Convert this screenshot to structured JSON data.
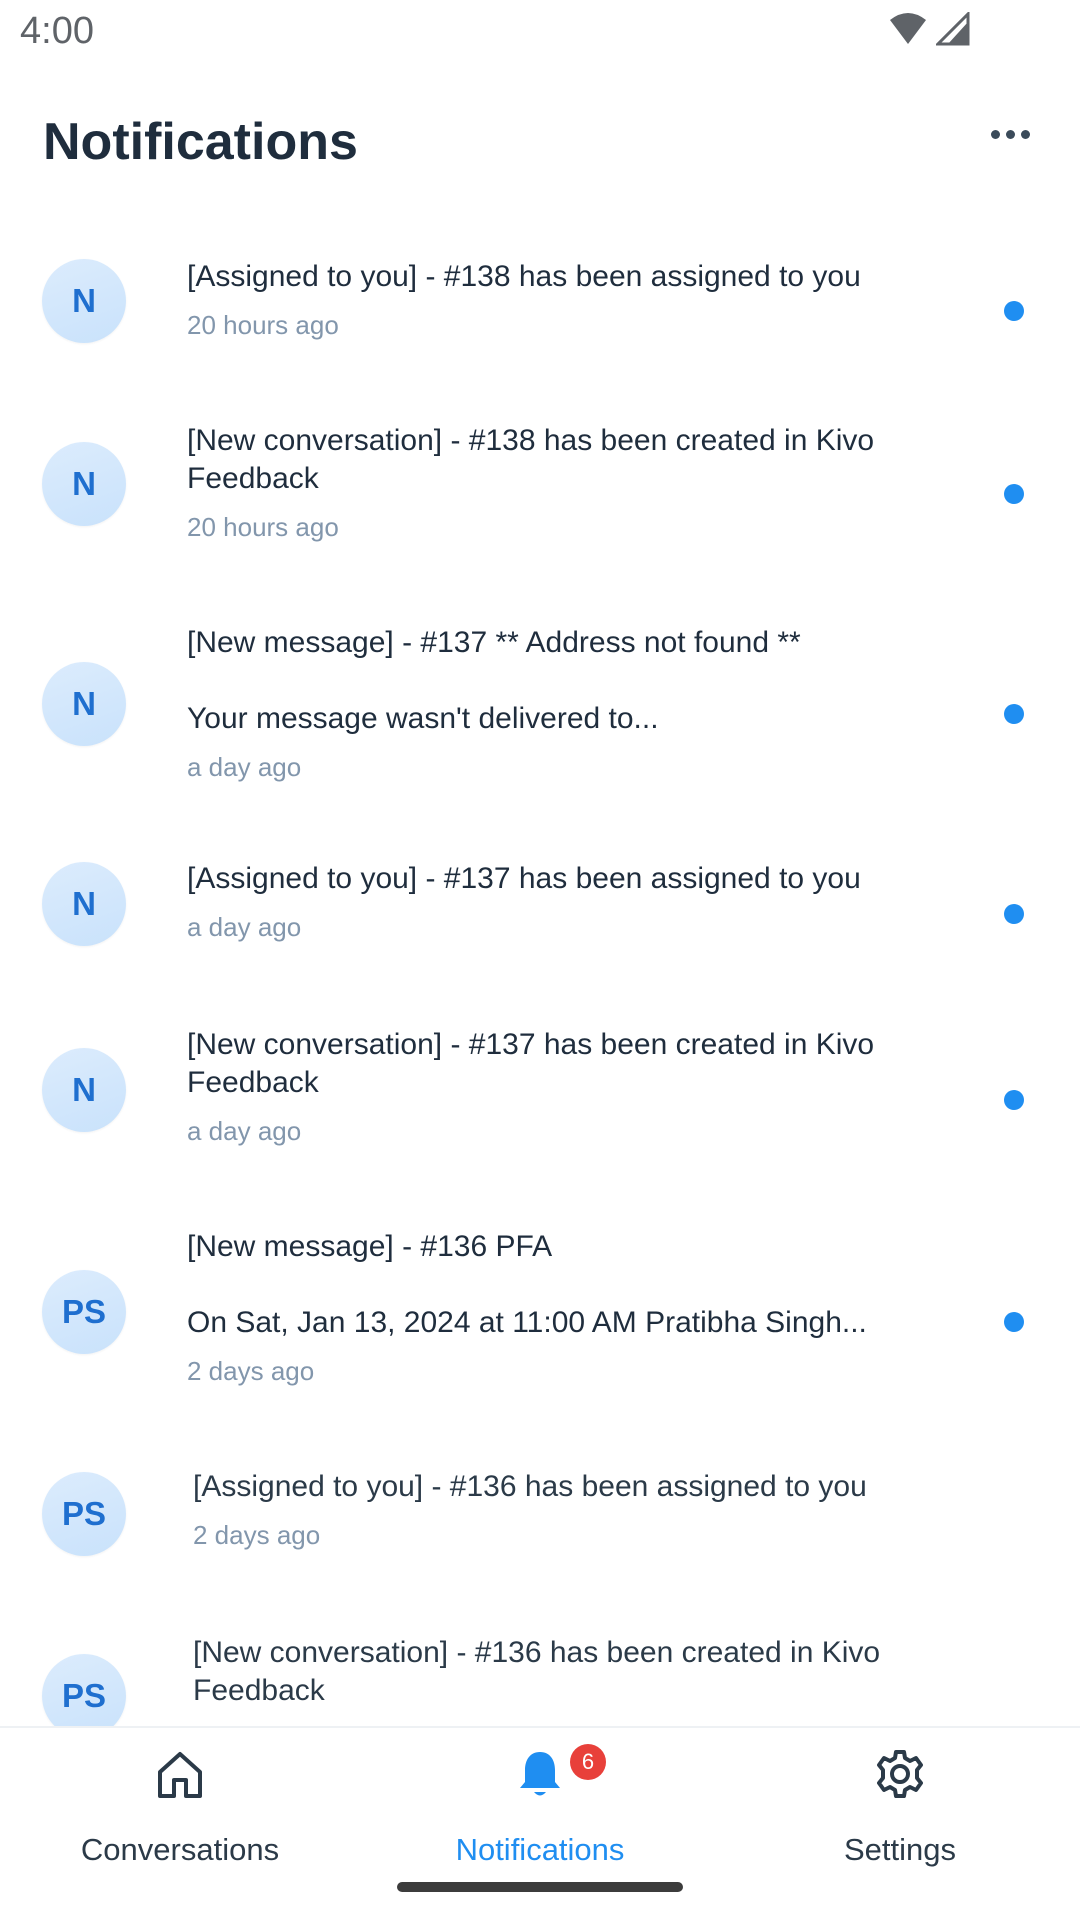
{
  "status_bar": {
    "time": "4:00"
  },
  "header": {
    "title": "Notifications"
  },
  "notifications": [
    {
      "avatar": "N",
      "title": "[Assigned to you] - #138 has been assigned to you",
      "body": "",
      "time": "20 hours ago",
      "unread": true
    },
    {
      "avatar": "N",
      "title": "[New conversation] - #138 has been created in Kivo Feedback",
      "body": "",
      "time": "20 hours ago",
      "unread": true
    },
    {
      "avatar": "N",
      "title": "[New message] - #137 ** Address not found **",
      "body": "Your message wasn't delivered to...",
      "time": "a day ago",
      "unread": true
    },
    {
      "avatar": "N",
      "title": "[Assigned to you] - #137 has been assigned to you",
      "body": "",
      "time": "a day ago",
      "unread": true
    },
    {
      "avatar": "N",
      "title": "[New conversation] - #137 has been created in Kivo Feedback",
      "body": "",
      "time": "a day ago",
      "unread": true
    },
    {
      "avatar": "PS",
      "title": "[New message] - #136 PFA",
      "body": "On Sat, Jan 13, 2024 at 11:00 AM Pratibha Singh...",
      "time": "2 days ago",
      "unread": true
    },
    {
      "avatar": "PS",
      "title": "[Assigned to you] - #136 has been assigned to you",
      "body": "",
      "time": "2 days ago",
      "unread": false
    },
    {
      "avatar": "PS",
      "title": "[New conversation] - #136 has been created in Kivo Feedback",
      "body": "",
      "time": "",
      "unread": false
    }
  ],
  "tabbar": {
    "tabs": [
      {
        "label": "Conversations",
        "icon": "home-icon",
        "active": false
      },
      {
        "label": "Notifications",
        "icon": "bell-icon",
        "active": true,
        "badge": "6"
      },
      {
        "label": "Settings",
        "icon": "gear-icon",
        "active": false
      }
    ]
  },
  "colors": {
    "accent": "#1f8ef1",
    "badge": "#e8403a",
    "text": "#1f2d3d",
    "muted": "#8296ac"
  }
}
